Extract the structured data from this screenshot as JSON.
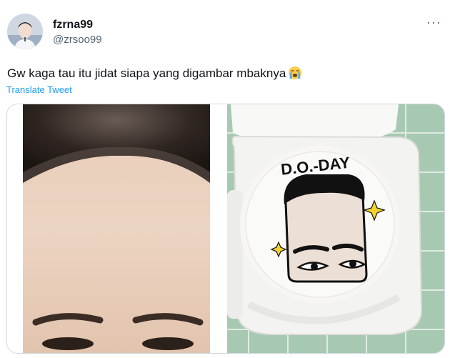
{
  "tweet": {
    "display_name": "fzrna99",
    "handle": "@zrsoo99",
    "text": "Gw kaga tau itu jidat siapa yang digambar mbaknya",
    "emoji": "loudly-crying-face",
    "translate_label": "Translate Tweet",
    "more_label": "···"
  },
  "media": {
    "photo_left": "forehead-closeup-photo",
    "photo_right": "bento-cake-photo",
    "cake_text": "D.O.-DAY"
  },
  "colors": {
    "link": "#1d9bf0",
    "secondary_text": "#536471",
    "border": "#cfd9de",
    "mat_green": "#a7c9b2"
  }
}
